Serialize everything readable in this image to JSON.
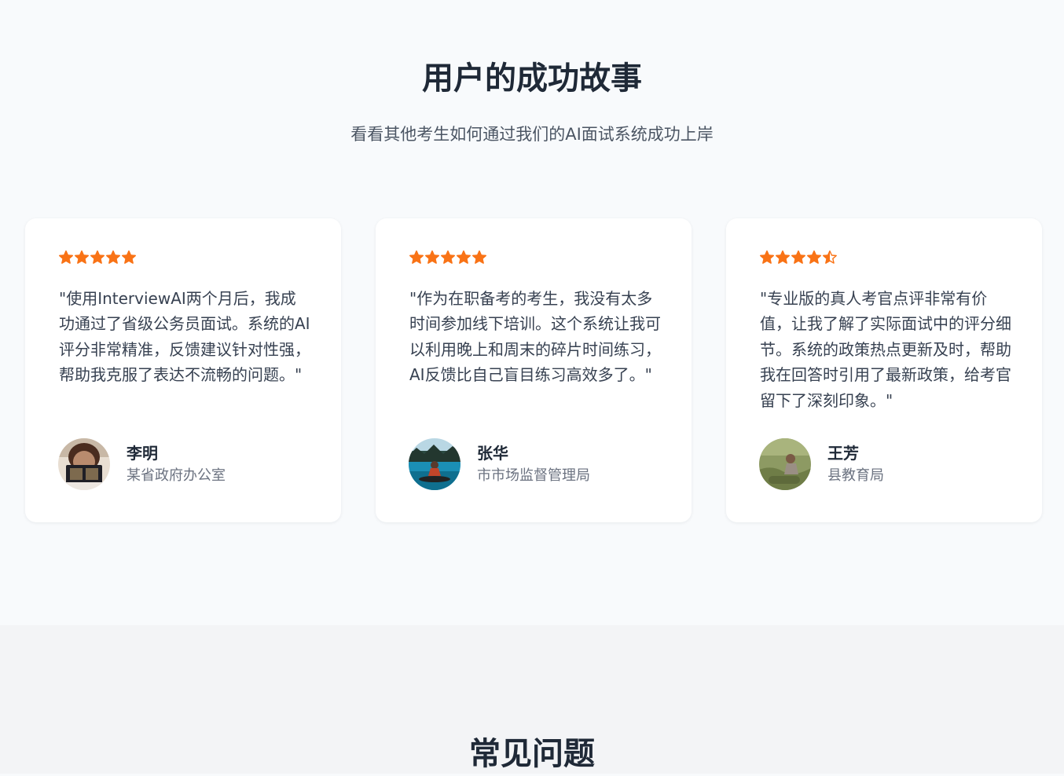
{
  "testimonials": {
    "title": "用户的成功故事",
    "subtitle": "看看其他考生如何通过我们的AI面试系统成功上岸",
    "star_color": "#f97316",
    "items": [
      {
        "rating": 5,
        "quote": "\"使用InterviewAI两个月后，我成功通过了省级公务员面试。系统的AI评分非常精准，反馈建议针对性强，帮助我克服了表达不流畅的问题。\"",
        "name": "李明",
        "organization": "某省政府办公室"
      },
      {
        "rating": 5,
        "quote": "\"作为在职备考的考生，我没有太多时间参加线下培训。这个系统让我可以利用晚上和周末的碎片时间练习，AI反馈比自己盲目练习高效多了。\"",
        "name": "张华",
        "organization": "市市场监督管理局"
      },
      {
        "rating": 4.5,
        "quote": "\"专业版的真人考官点评非常有价值，让我了解了实际面试中的评分细节。系统的政策热点更新及时，帮助我在回答时引用了最新政策，给考官留下了深刻印象。\"",
        "name": "王芳",
        "organization": "县教育局"
      }
    ]
  },
  "faq": {
    "title": "常见问题"
  }
}
